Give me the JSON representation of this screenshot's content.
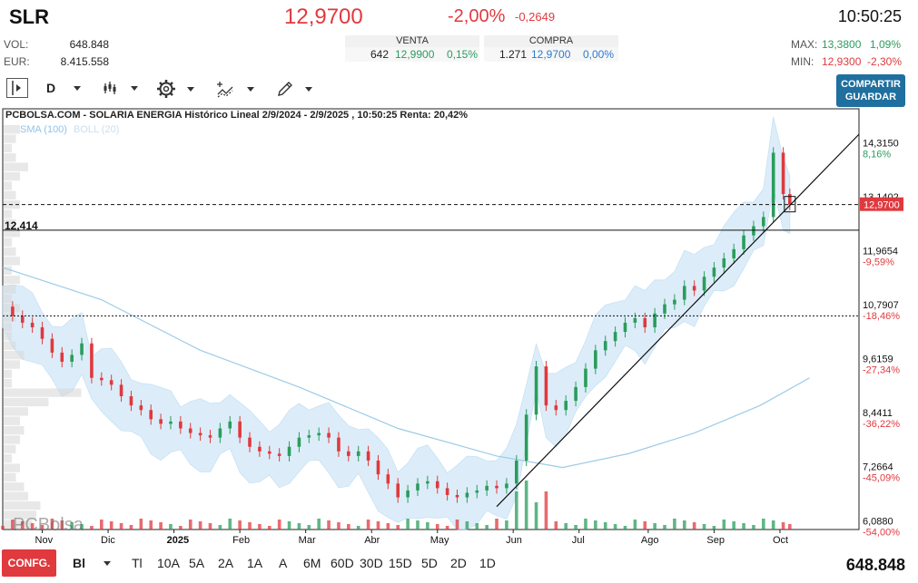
{
  "header": {
    "ticker": "SLR",
    "price": "12,9700",
    "change_pct": "-2,00%",
    "change_abs": "-0,2649",
    "time": "10:50:25",
    "vol_label": "VOL:",
    "vol_value": "648.848",
    "eur_label": "EUR:",
    "eur_value": "8.415.558",
    "venta_label": "VENTA",
    "venta_qty": "642",
    "venta_price": "12,9900",
    "venta_pct": "0,15%",
    "compra_label": "COMPRA",
    "compra_qty": "1.271",
    "compra_price": "12,9700",
    "compra_pct": "0,00%",
    "max_label": "MAX:",
    "max_value": "13,3800",
    "max_pct": "1,09%",
    "min_label": "MIN:",
    "min_value": "12,9300",
    "min_pct": "-2,30%"
  },
  "toolbar": {
    "period": "D",
    "share_line1": "COMPARTIR",
    "share_line2": "GUARDAR"
  },
  "chart_info": {
    "title": "PCBOLSA.COM - SOLARIA ENERGIA Histórico Lineal 2/9/2024 - 2/9/2025 , 10:50:25 Renta: 20,42%",
    "legend_sma": "SMA (100)",
    "legend_boll": "BOLL (20)",
    "support_label": "12,414",
    "watermark": "PCBolsa",
    "current_price_tag": "12,9700"
  },
  "colors": {
    "up": "#2a9d5c",
    "down": "#e0393e",
    "band": "#d6ebf8",
    "sma": "#9ccbe8",
    "accent": "#1f6f9f"
  },
  "chart_data": {
    "type": "candlestick",
    "title": "PCBOLSA.COM - SOLARIA ENERGIA Histórico Lineal 2/9/2024 - 2/9/2025 , 10:50:25 Renta: 20,42%",
    "y_ticks": [
      {
        "value": "14,3150",
        "pct": "8,16%"
      },
      {
        "value": "13,1402",
        "pct": ""
      },
      {
        "value": "11,9654",
        "pct": "-9,59%"
      },
      {
        "value": "10,7907",
        "pct": "-18,46%"
      },
      {
        "value": "9,6159",
        "pct": "-27,34%"
      },
      {
        "value": "8,4411",
        "pct": "-36,22%"
      },
      {
        "value": "7,2664",
        "pct": "-45,09%"
      },
      {
        "value": "6,0880",
        "pct": "-54,00%"
      }
    ],
    "x_ticks": [
      "Nov",
      "Dic",
      "2025",
      "Feb",
      "Mar",
      "Abr",
      "May",
      "Jun",
      "Jul",
      "Ago",
      "Sep",
      "Oct"
    ],
    "series_close": [
      [
        0,
        10.75
      ],
      [
        3,
        10.55
      ],
      [
        6,
        10.4
      ],
      [
        9,
        10.3
      ],
      [
        12,
        10.05
      ],
      [
        15,
        9.75
      ],
      [
        18,
        9.55
      ],
      [
        21,
        9.7
      ],
      [
        24,
        9.95
      ],
      [
        27,
        9.2
      ],
      [
        30,
        9.15
      ],
      [
        33,
        9.05
      ],
      [
        36,
        8.8
      ],
      [
        39,
        8.6
      ],
      [
        42,
        8.5
      ],
      [
        45,
        8.3
      ],
      [
        48,
        8.2
      ],
      [
        51,
        8.25
      ],
      [
        54,
        8.1
      ],
      [
        57,
        8.0
      ],
      [
        60,
        7.95
      ],
      [
        63,
        7.9
      ],
      [
        66,
        8.1
      ],
      [
        69,
        8.25
      ],
      [
        72,
        7.9
      ],
      [
        75,
        7.7
      ],
      [
        78,
        7.6
      ],
      [
        81,
        7.55
      ],
      [
        84,
        7.5
      ],
      [
        87,
        7.7
      ],
      [
        90,
        7.9
      ],
      [
        93,
        7.95
      ],
      [
        96,
        8.0
      ],
      [
        99,
        7.9
      ],
      [
        102,
        7.6
      ],
      [
        105,
        7.5
      ],
      [
        108,
        7.6
      ],
      [
        111,
        7.4
      ],
      [
        114,
        7.1
      ],
      [
        117,
        6.9
      ],
      [
        120,
        6.6
      ],
      [
        123,
        6.75
      ],
      [
        126,
        6.9
      ],
      [
        129,
        6.95
      ],
      [
        132,
        6.8
      ],
      [
        135,
        6.65
      ],
      [
        138,
        6.6
      ],
      [
        141,
        6.7
      ],
      [
        144,
        6.75
      ],
      [
        147,
        6.85
      ],
      [
        150,
        6.8
      ],
      [
        153,
        6.9
      ],
      [
        156,
        7.4
      ],
      [
        159,
        8.4
      ],
      [
        162,
        9.45
      ],
      [
        165,
        8.6
      ],
      [
        168,
        8.5
      ],
      [
        171,
        8.7
      ],
      [
        174,
        9.0
      ],
      [
        177,
        9.4
      ],
      [
        180,
        9.8
      ],
      [
        183,
        10.0
      ],
      [
        186,
        10.2
      ],
      [
        189,
        10.4
      ],
      [
        192,
        10.5
      ],
      [
        195,
        10.3
      ],
      [
        198,
        10.6
      ],
      [
        201,
        10.8
      ],
      [
        204,
        10.9
      ],
      [
        207,
        11.2
      ],
      [
        210,
        11.1
      ],
      [
        213,
        11.4
      ],
      [
        216,
        11.6
      ],
      [
        219,
        11.8
      ],
      [
        222,
        12.0
      ],
      [
        225,
        12.3
      ],
      [
        228,
        12.5
      ],
      [
        231,
        12.7
      ],
      [
        234,
        14.1
      ],
      [
        237,
        13.2
      ],
      [
        239,
        12.97
      ]
    ],
    "sma_100": [
      [
        0,
        11.6
      ],
      [
        30,
        10.9
      ],
      [
        60,
        9.8
      ],
      [
        90,
        9.0
      ],
      [
        120,
        8.1
      ],
      [
        150,
        7.5
      ],
      [
        170,
        7.25
      ],
      [
        190,
        7.55
      ],
      [
        210,
        8.0
      ],
      [
        230,
        8.6
      ],
      [
        245,
        9.2
      ]
    ],
    "volume_levels": [
      0.2,
      0.15,
      0.1,
      0.15,
      0.3,
      0.2,
      0.1,
      0.15,
      0.2,
      0.1,
      0.15,
      0.2,
      0.1,
      0.15,
      0.2,
      0.1,
      0.2,
      0.15,
      0.1,
      0.2,
      0.15,
      0.1,
      0.1,
      0.15,
      0.25,
      0.2,
      0.1,
      0.1,
      0.95,
      0.55,
      0.3,
      0.2,
      0.25,
      0.2,
      0.15,
      0.1,
      0.2,
      0.15,
      0.25,
      0.3,
      0.45,
      0.4,
      0.35
    ],
    "support_level": 12.414,
    "current_price": 12.97
  }
}
